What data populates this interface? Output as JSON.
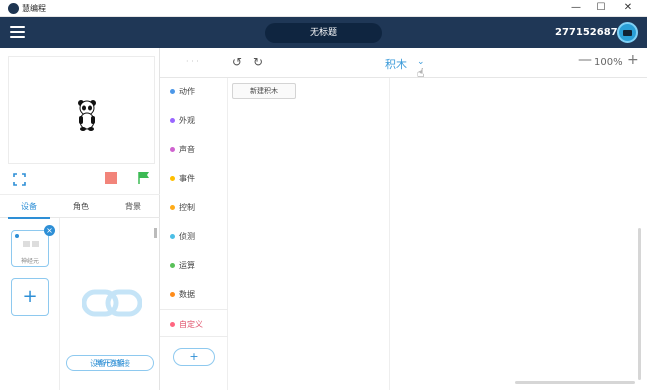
{
  "window": {
    "app_title": "慧编程",
    "minimize": "—",
    "maximize": "☐",
    "close": "✕"
  },
  "header": {
    "project_title": "无标题",
    "user_id": "277152687"
  },
  "stage_controls": {
    "fullscreen_icon": "fullscreen-icon",
    "stop_color": "#f2847a",
    "flag_color": "#3cba54"
  },
  "tabs": [
    {
      "label": "设备",
      "active": true
    },
    {
      "label": "角色",
      "active": false
    },
    {
      "label": "背景",
      "active": false
    }
  ],
  "devices": {
    "card_name": "神经元",
    "add_symbol": "+",
    "close_symbol": "×",
    "status": "设备已连接",
    "disconnect_label": "断开连接"
  },
  "toolbar": {
    "undo": "↺",
    "redo": "↻",
    "mode_label": "积木",
    "chevron": "⌄",
    "zoom_out": "—",
    "zoom_level": "100%",
    "zoom_in": "+"
  },
  "categories": [
    {
      "label": "动作",
      "color": "#4c97e8"
    },
    {
      "label": "外观",
      "color": "#9966ff"
    },
    {
      "label": "声音",
      "color": "#cf63cf"
    },
    {
      "label": "事件",
      "color": "#ffbf00"
    },
    {
      "label": "控制",
      "color": "#ffab19"
    },
    {
      "label": "侦测",
      "color": "#4cbfe6"
    },
    {
      "label": "运算",
      "color": "#59c059"
    },
    {
      "label": "数据",
      "color": "#ff8c1a"
    },
    {
      "label": "自定义",
      "color": "#ff6680"
    }
  ],
  "add_extension": "+",
  "palette": {
    "new_block_label": "新建积木"
  }
}
